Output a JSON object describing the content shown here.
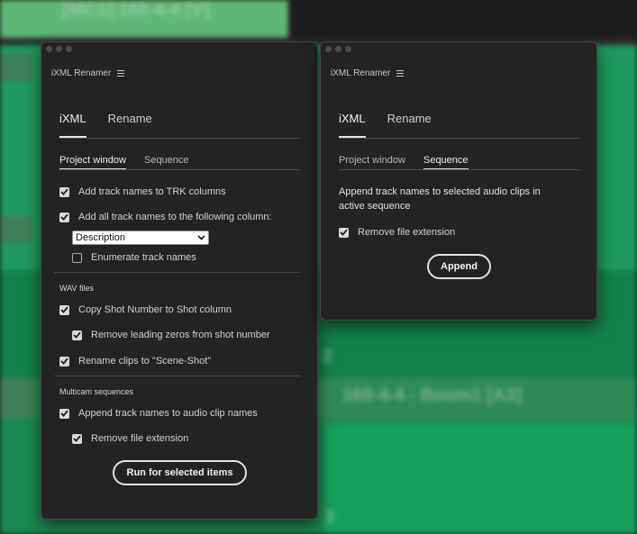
{
  "background": {
    "clip_label_top": "[MC1] 160-4-4 [V]",
    "clip_label_mid": "160-4-4 - Boom1 [A3]",
    "track_num_a": "2",
    "track_num_b": "3"
  },
  "left_panel": {
    "title": "iXML Renamer",
    "tabs": [
      {
        "label": "iXML",
        "active": true
      },
      {
        "label": "Rename",
        "active": false
      }
    ],
    "sub_tabs": [
      {
        "label": "Project window",
        "active": true
      },
      {
        "label": "Sequence",
        "active": false
      }
    ],
    "options": {
      "add_trk": {
        "label": "Add track names to TRK columns",
        "checked": true
      },
      "add_all": {
        "label": "Add all track names to the following column:",
        "checked": true
      },
      "column_select": {
        "value": "Description"
      },
      "enumerate": {
        "label": "Enumerate track names",
        "checked": false
      }
    },
    "wav_section": {
      "label": "WAV files",
      "copy_shot": {
        "label": "Copy Shot Number to Shot column",
        "checked": true
      },
      "remove_zeros": {
        "label": "Remove leading zeros from shot number",
        "checked": true
      },
      "rename_clips": {
        "label": "Rename clips to \"Scene-Shot\"",
        "checked": true
      }
    },
    "multicam_section": {
      "label": "Multicam sequences",
      "append_names": {
        "label": "Append track names to audio clip names",
        "checked": true
      },
      "remove_ext": {
        "label": "Remove file extension",
        "checked": true
      }
    },
    "run_button": "Run for selected items"
  },
  "right_panel": {
    "title": "iXML Renamer",
    "tabs": [
      {
        "label": "iXML",
        "active": true
      },
      {
        "label": "Rename",
        "active": false
      }
    ],
    "sub_tabs": [
      {
        "label": "Project window",
        "active": false
      },
      {
        "label": "Sequence",
        "active": true
      }
    ],
    "description": "Append track names to selected audio clips in active sequence",
    "remove_ext": {
      "label": "Remove file extension",
      "checked": true
    },
    "append_button": "Append"
  },
  "colors": {
    "panel_bg": "#232323",
    "track_green": "#1f9a5f",
    "track_green_dark": "#137a46"
  }
}
